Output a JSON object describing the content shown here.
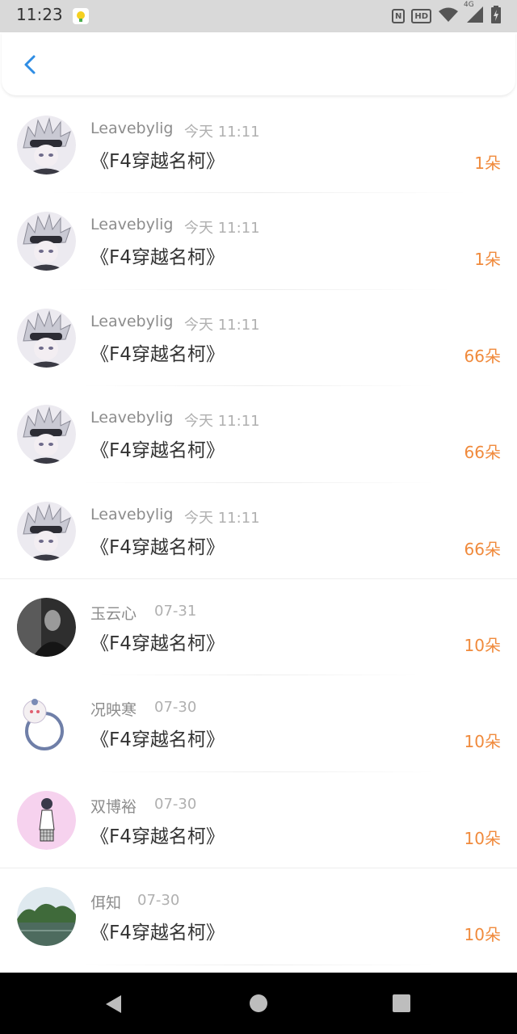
{
  "status_bar": {
    "time": "11:23",
    "network": "4G",
    "hd_label": "HD",
    "nfc_label": "N"
  },
  "header": {
    "back_icon": "chevron-left-icon",
    "accent_color": "#2f8de4"
  },
  "items": [
    {
      "name": "Leavebylig",
      "time": "今天 11:11",
      "title": "《F4穿越名柯》",
      "count": "1朵",
      "avatar": "anime-avatar"
    },
    {
      "name": "Leavebylig",
      "time": "今天 11:11",
      "title": "《F4穿越名柯》",
      "count": "1朵",
      "avatar": "anime-avatar"
    },
    {
      "name": "Leavebylig",
      "time": "今天 11:11",
      "title": "《F4穿越名柯》",
      "count": "66朵",
      "avatar": "anime-avatar"
    },
    {
      "name": "Leavebylig",
      "time": "今天 11:11",
      "title": "《F4穿越名柯》",
      "count": "66朵",
      "avatar": "anime-avatar"
    },
    {
      "name": "Leavebylig",
      "time": "今天 11:11",
      "title": "《F4穿越名柯》",
      "count": "66朵",
      "avatar": "anime-avatar"
    },
    {
      "name": "玉云心",
      "time": "07-31",
      "title": "《F4穿越名柯》",
      "count": "10朵",
      "avatar": "photo-avatar"
    },
    {
      "name": "况映寒",
      "time": "07-30",
      "title": "《F4穿越名柯》",
      "count": "10朵",
      "avatar": "cartoon-avatar"
    },
    {
      "name": "双博裕",
      "time": "07-30",
      "title": "《F4穿越名柯》",
      "count": "10朵",
      "avatar": "girl-avatar"
    },
    {
      "name": "佴知",
      "time": "07-30",
      "title": "《F4穿越名柯》",
      "count": "10朵",
      "avatar": "landscape-avatar"
    }
  ],
  "colors": {
    "count": "#f08a3c",
    "name": "#8c8c8c",
    "time": "#b0b0b0",
    "title": "#333333"
  },
  "nav_bar": {
    "back_icon": "triangle-back-icon",
    "home_icon": "circle-home-icon",
    "recents_icon": "square-recents-icon"
  }
}
